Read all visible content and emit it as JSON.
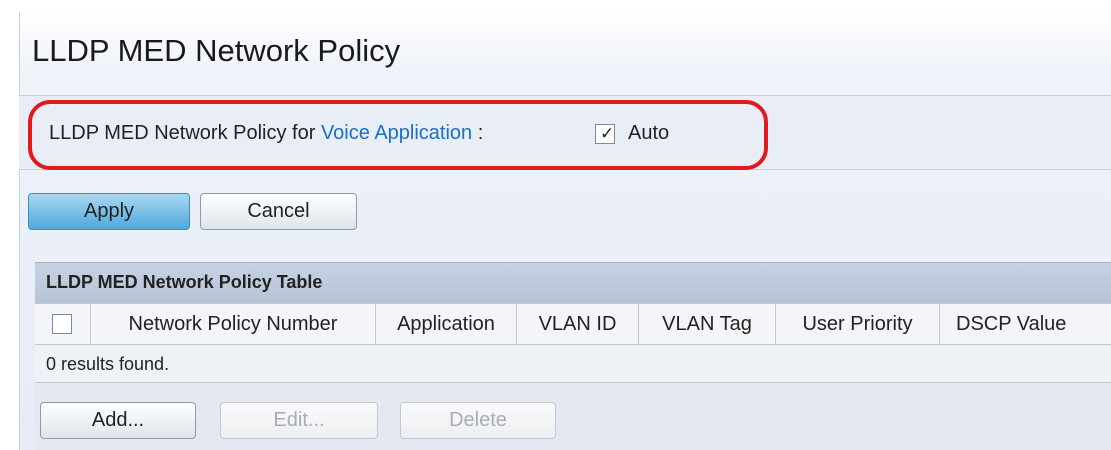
{
  "page": {
    "title": "LLDP MED Network Policy"
  },
  "voice_policy": {
    "label_prefix": "LLDP MED Network Policy for ",
    "link_text": "Voice Application",
    "label_suffix": " :",
    "auto_checked": true,
    "auto_label": "Auto",
    "checkmark": "✓"
  },
  "buttons": {
    "apply": "Apply",
    "cancel": "Cancel",
    "add": "Add...",
    "edit": "Edit...",
    "delete": "Delete"
  },
  "table": {
    "title": "LLDP MED Network Policy Table",
    "columns": [
      "Network Policy Number",
      "Application",
      "VLAN ID",
      "VLAN Tag",
      "User Priority",
      "DSCP Value"
    ],
    "results_text": "0 results found."
  },
  "colors": {
    "highlight": "#e0191d",
    "link": "#1a6fc7",
    "apply_button": "#4fa8dc"
  }
}
